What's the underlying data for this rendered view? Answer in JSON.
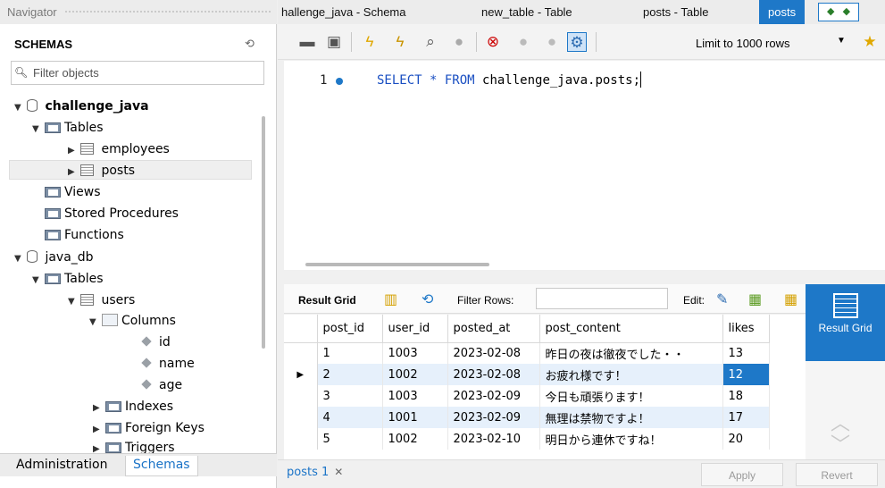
{
  "navigator": {
    "header": "Navigator",
    "title": "SCHEMAS",
    "filter_placeholder": "Filter objects",
    "tree": {
      "db1": "challenge_java",
      "tables": "Tables",
      "employees": "employees",
      "posts": "posts",
      "views": "Views",
      "stored_procedures": "Stored Procedures",
      "functions": "Functions",
      "db2": "java_db",
      "tables2": "Tables",
      "users": "users",
      "columns": "Columns",
      "col_id": "id",
      "col_name": "name",
      "col_age": "age",
      "indexes": "Indexes",
      "foreign_keys": "Foreign Keys",
      "triggers": "Triggers"
    },
    "tabs": [
      "Administration",
      "Schemas"
    ]
  },
  "editor_tabs": [
    "hallenge_java - Schema",
    "new_table - Table",
    "posts - Table",
    "posts"
  ],
  "toolbar": {
    "limit": "Limit to 1000 rows"
  },
  "editor": {
    "line_number": "1",
    "kw1": "SELECT",
    "star": " * ",
    "kw2": "FROM",
    "rest": " challenge_java.posts;"
  },
  "results": {
    "result_grid_label": "Result Grid",
    "filter_label": "Filter Rows:",
    "edit_label": "Edit:",
    "columns": [
      "post_id",
      "user_id",
      "posted_at",
      "post_content",
      "likes"
    ],
    "rows": [
      [
        "1",
        "1003",
        "2023-02-08",
        "昨日の夜は徹夜でした・・",
        "13"
      ],
      [
        "2",
        "1002",
        "2023-02-08",
        "お疲れ様です！",
        "12"
      ],
      [
        "3",
        "1003",
        "2023-02-09",
        "今日も頑張ります！",
        "18"
      ],
      [
        "4",
        "1001",
        "2023-02-09",
        "無理は禁物ですよ！",
        "17"
      ],
      [
        "5",
        "1002",
        "2023-02-10",
        "明日から連休ですね！",
        "20"
      ]
    ],
    "side_button": "Result Grid",
    "result_tab": "posts 1",
    "apply": "Apply",
    "revert": "Revert"
  }
}
